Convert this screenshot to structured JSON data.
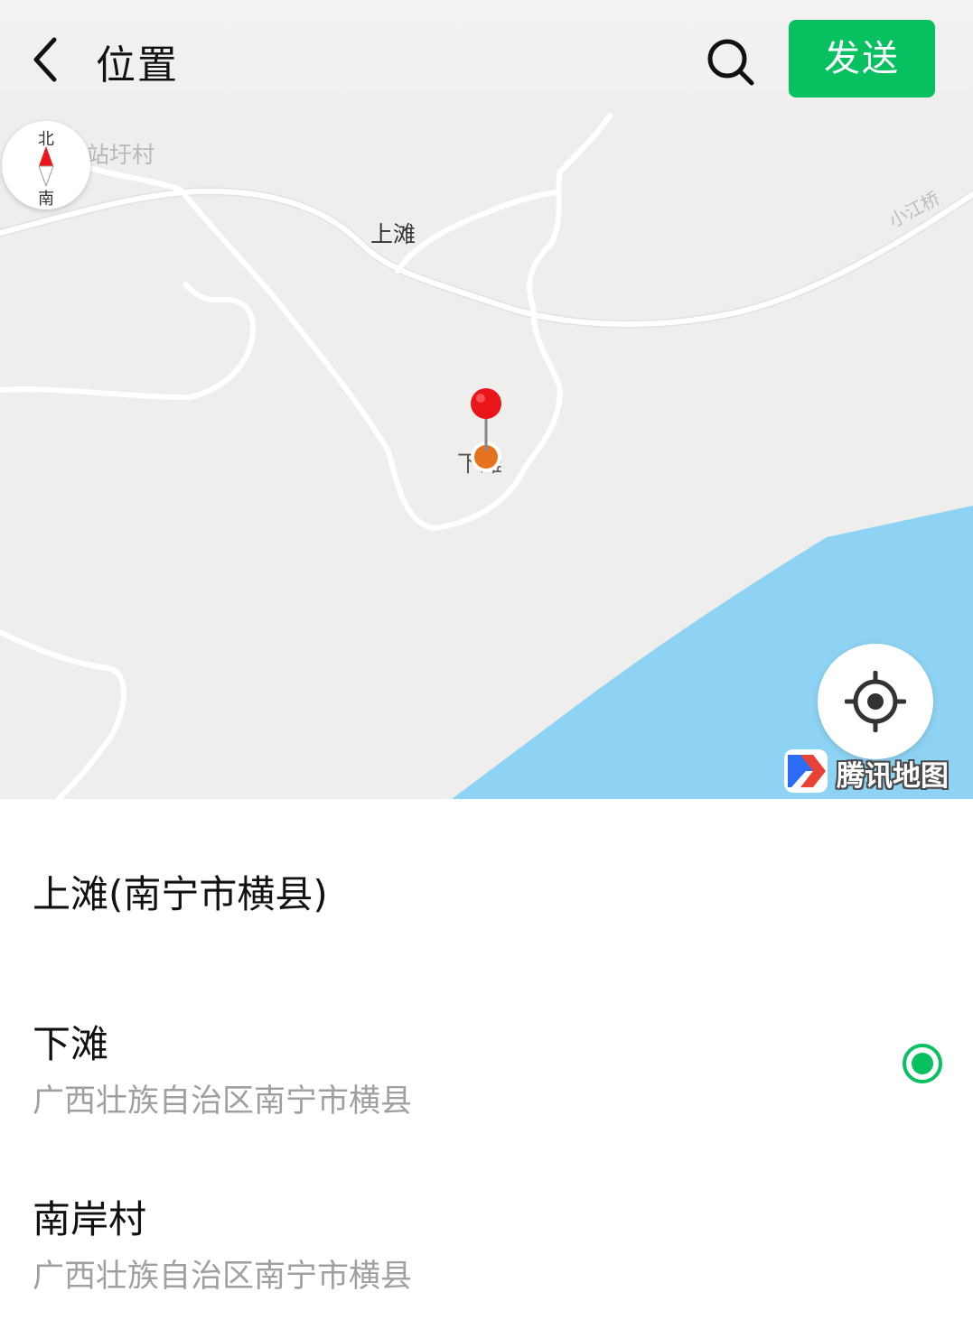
{
  "header": {
    "title": "位置",
    "send_label": "发送"
  },
  "map": {
    "compass": {
      "north": "北",
      "south": "南"
    },
    "labels": {
      "village_1": "站圩村",
      "village_2": "上滩",
      "bridge": "小江桥",
      "selected_place": "下滩"
    },
    "brand": "腾讯地图",
    "colors": {
      "land": "#eeeeec",
      "road": "#ffffff",
      "water": "#8fd3f4",
      "pin": "#e8151b",
      "marker": "#e8711e"
    }
  },
  "poi_list": [
    {
      "name": "上滩(南宁市横县)",
      "address": "",
      "selected": false
    },
    {
      "name": "下滩",
      "address": "广西壮族自治区南宁市横县",
      "selected": true
    },
    {
      "name": "南岸村",
      "address": "广西壮族自治区南宁市横县",
      "selected": false
    }
  ],
  "accent_color": "#07c160",
  "icons": {
    "back": "back-arrow-icon",
    "search": "search-icon",
    "locate": "locate-target-icon",
    "compass": "compass-icon",
    "pin": "map-pin-icon",
    "radio": "radio-selected-icon"
  }
}
